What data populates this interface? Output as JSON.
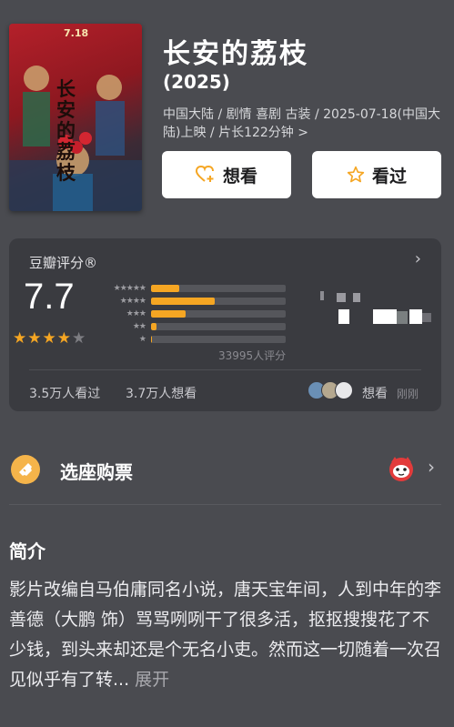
{
  "movie": {
    "title": "长安的荔枝",
    "year": "(2025)",
    "meta": "中国大陆 / 剧情 喜剧 古装 / 2025-07-18(中国大陆)上映 / 片长122分钟 >",
    "poster": {
      "badge": "7.18",
      "headline": "长安的荔枝"
    }
  },
  "actions": {
    "want_label": "想看",
    "seen_label": "看过",
    "want_icon": "heart-plus-icon",
    "seen_icon": "star-outline-icon"
  },
  "rating": {
    "label": "豆瓣评分®",
    "score": "7.7",
    "stars": 4,
    "distribution_percent": {
      "5": 21,
      "4": 47,
      "3": 26,
      "2": 4,
      "1": 1
    },
    "count_text": "33995人评分",
    "seen_text": "3.5万人看过",
    "wanted_text": "3.7万人想看",
    "friends_want_label": "想看",
    "friends_time": "刚刚",
    "accent_color": "#f5a623"
  },
  "ticket": {
    "label": "选座购票",
    "ticket_icon": "ticket-icon",
    "brand_icon": "cat-icon"
  },
  "intro": {
    "title": "简介",
    "text": "影片改编自马伯庸同名小说，唐天宝年间，人到中年的李善德（大鹏 饰）骂骂咧咧干了很多活，抠抠搜搜花了不少钱，到头来却还是个无名小吏。然而这一切随着一次召见似乎有了转... ",
    "expand_label": "展开"
  }
}
